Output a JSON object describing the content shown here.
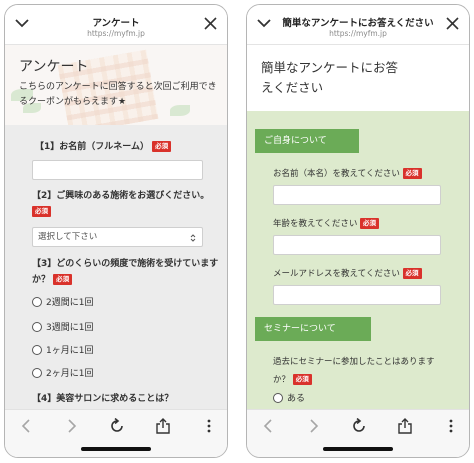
{
  "left_screen": {
    "topbar": {
      "title": "アンケート",
      "url": "https://myfm.jp"
    },
    "hero": {
      "title": "アンケート",
      "description": "こちらのアンケートに回答すると次回ご利用できるクーポンがもらえます★"
    },
    "required_badge": "必須",
    "questions": [
      {
        "label": "【1】お名前（フルネーム）",
        "type": "text",
        "value": ""
      },
      {
        "label": "【2】ご興味のある施術をお選びください。",
        "type": "select",
        "selected": "選択して下さい"
      },
      {
        "label": "【3】どのくらいの頻度で施術を受けていますか？",
        "type": "radio",
        "options": [
          "2週間に1回",
          "3週間に1回",
          "1ヶ月に1回",
          "2ヶ月に1回"
        ]
      },
      {
        "label": "【4】美容サロンに求めることは？"
      }
    ]
  },
  "right_screen": {
    "topbar": {
      "title": "簡単なアンケートにお答えください",
      "url": "https://myfm.jp"
    },
    "page_title": "簡単なアンケートにお答えください",
    "required_badge": "必須",
    "sections": [
      {
        "title": "ご自身について",
        "fields": [
          {
            "label": "お名前（本名）を教えてください",
            "value": ""
          },
          {
            "label": "年齢を教えてください",
            "value": ""
          },
          {
            "label": "メールアドレスを教えてください",
            "value": ""
          }
        ]
      },
      {
        "title": "セミナーについて",
        "question": "過去にセミナーに参加したことはありますか？",
        "options": [
          "ある"
        ]
      }
    ]
  },
  "browser_toolbar": {
    "icons": [
      "back-icon",
      "forward-icon",
      "reload-icon",
      "share-icon",
      "more-icon"
    ]
  },
  "colors": {
    "required_red": "#d9322b",
    "section_green": "#6bab57",
    "form_green_bg": "#ddeacd",
    "form_gray_bg": "#ececec"
  }
}
